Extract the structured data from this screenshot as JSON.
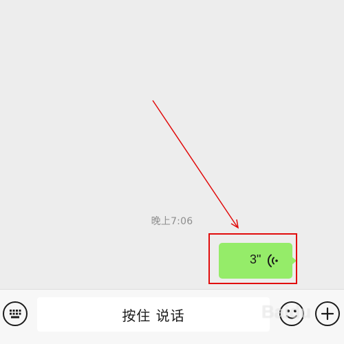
{
  "chat": {
    "timestamp": "晚上7:06",
    "voice_message": {
      "duration": "3\""
    }
  },
  "input_bar": {
    "hold_to_talk_label": "按住 说话",
    "left_icon": "keyboard-icon",
    "emoji_icon": "emoji-icon",
    "plus_icon": "plus-icon"
  },
  "annotation": {
    "color": "#e10b0b"
  },
  "colors": {
    "bubble": "#95ec69",
    "background": "#ededed",
    "input_bar": "#f7f7f7"
  }
}
